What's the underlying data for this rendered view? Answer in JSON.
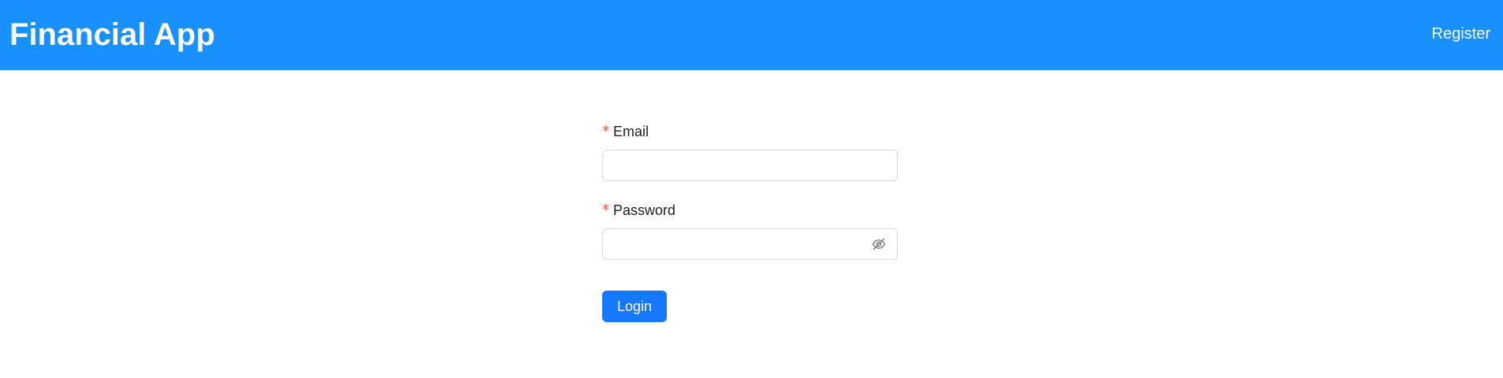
{
  "header": {
    "title": "Financial App",
    "register_label": "Register",
    "background_color": "#1890ff"
  },
  "form": {
    "email": {
      "required_mark": "*",
      "label": "Email",
      "value": "",
      "placeholder": ""
    },
    "password": {
      "required_mark": "*",
      "label": "Password",
      "value": "",
      "placeholder": "",
      "visibility_icon": "eye-invisible-icon"
    },
    "login_label": "Login",
    "primary_color": "#1677ff",
    "required_color": "#ff4d4f"
  }
}
